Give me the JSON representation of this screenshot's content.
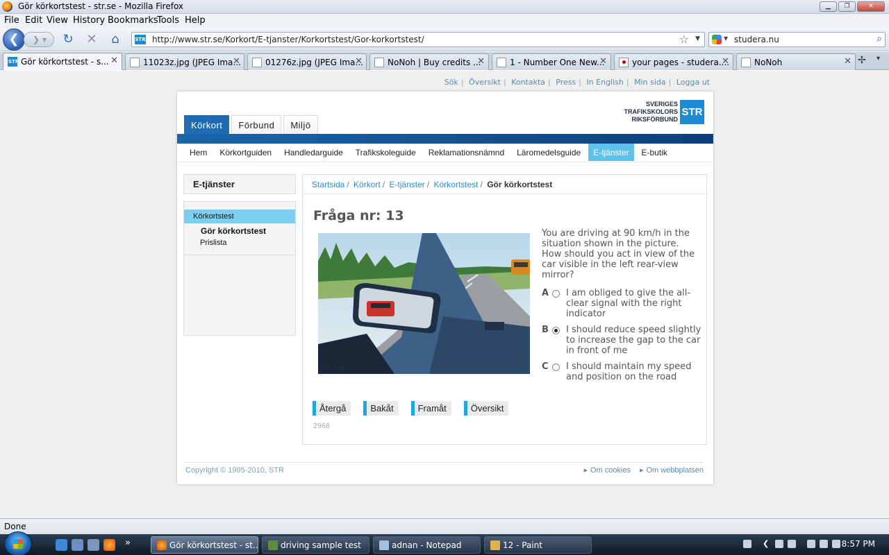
{
  "window": {
    "title": "Gör körkortstest - str.se - Mozilla Firefox"
  },
  "menu": [
    "File",
    "Edit",
    "View",
    "History",
    "Bookmarks",
    "Tools",
    "Help"
  ],
  "address": {
    "url": "http://www.str.se/Korkort/E-tjanster/Korkortstest/Gor-korkortstest/",
    "site_icon": "STR"
  },
  "search": {
    "value": "studera.nu"
  },
  "tabs": [
    {
      "label": "Gör körkortstest - s...",
      "icon": "str-icon"
    },
    {
      "label": "11023z.jpg (JPEG Ima...",
      "icon": "image-icon"
    },
    {
      "label": "01276z.jpg (JPEG Ima...",
      "icon": "image-icon"
    },
    {
      "label": "NoNoh | Buy credits ...",
      "icon": "page-icon"
    },
    {
      "label": "1 - Number One New...",
      "icon": "site-icon"
    },
    {
      "label": "your pages - studera....",
      "icon": "flag-icon"
    },
    {
      "label": "NoNoh",
      "icon": "page-icon"
    }
  ],
  "site": {
    "top_links": [
      "Sök",
      "Översikt",
      "Kontakta",
      "Press",
      "In English",
      "Min sida",
      "Logga ut"
    ],
    "logo": {
      "line1": "SVERIGES",
      "line2": "TRAFIKSKOLORS",
      "line3": "RIKSFÖRBUND",
      "mark": "STR"
    },
    "main_tabs": [
      "Körkort",
      "Förbund",
      "Miljö"
    ],
    "sub_nav": [
      "Hem",
      "Körkortguiden",
      "Handledarguide",
      "Trafikskoleguide",
      "Reklamationsnämnd",
      "Läromedelsguide",
      "E-tjänster",
      "E-butik"
    ],
    "sidebar": {
      "heading": "E-tjänster",
      "items": [
        "Körkortstest",
        "Gör körkortstest",
        "Prislista"
      ]
    },
    "breadcrumb": [
      "Startsida",
      "Körkort",
      "E-tjänster",
      "Körkortstest",
      "Gör körkortstest"
    ],
    "question": {
      "title": "Fråga nr: 13",
      "text": "You are driving at 90 km/h in the situation shown in the picture. How should you act in view of the car visible in the left rear-view mirror?",
      "answers": [
        {
          "letter": "A",
          "text": "I am obliged to give the all-clear signal with the right indicator",
          "checked": false
        },
        {
          "letter": "B",
          "text": "I should reduce speed slightly to increase the gap to the car in front of me",
          "checked": true
        },
        {
          "letter": "C",
          "text": "I should maintain my speed and position on the road",
          "checked": false
        }
      ],
      "buttons": [
        "Återgå",
        "Bakåt",
        "Framåt",
        "Översikt"
      ],
      "id": "2968",
      "illustration_signature": "U.P. Stare"
    },
    "footer": {
      "copyright": "Copyright © 1995-2010, STR",
      "links": [
        "Om cookies",
        "Om webbplatsen"
      ]
    }
  },
  "status": {
    "text": "Done"
  },
  "taskbar": {
    "tasks": [
      {
        "label": "Gör körkortstest - st...",
        "active": true
      },
      {
        "label": "driving sample test",
        "active": false
      },
      {
        "label": "adnan - Notepad",
        "active": false
      },
      {
        "label": "12 - Paint",
        "active": false
      }
    ],
    "overflow": "»",
    "clock": "8:57 PM"
  }
}
